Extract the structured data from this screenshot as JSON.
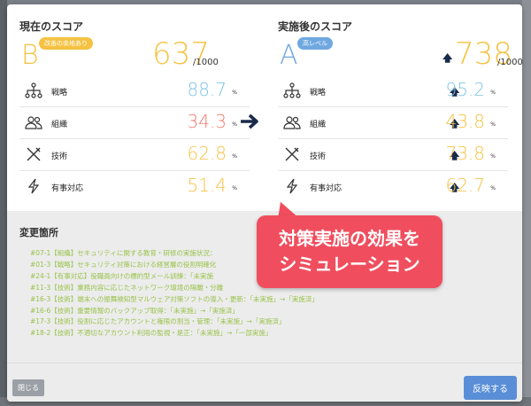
{
  "colors": {
    "grade_b": "#f5c242",
    "grade_a": "#6fa8e0",
    "badge_b": "#f5c242",
    "badge_a": "#6fa8e0",
    "strategy": "#7ec3e6",
    "organization": "#ee7b6d",
    "technology": "#f5c242",
    "incident": "#f5c242",
    "changes_text": "#9ac24b",
    "callout": "#f04e5e",
    "apply_button": "#5a8fd8"
  },
  "current": {
    "title": "現在のスコア",
    "grade": "B",
    "badge": "改善の余地あり",
    "score": "637",
    "max": "/1000",
    "metrics": [
      {
        "label": "戦略",
        "value": "88.7",
        "unit": "%",
        "icon": "hierarchy-icon"
      },
      {
        "label": "組織",
        "value": "34.3",
        "unit": "%",
        "icon": "people-icon"
      },
      {
        "label": "技術",
        "value": "62.8",
        "unit": "%",
        "icon": "tools-icon"
      },
      {
        "label": "有事対応",
        "value": "51.4",
        "unit": "%",
        "icon": "lightning-icon"
      }
    ]
  },
  "after": {
    "title": "実施後のスコア",
    "grade": "A",
    "badge": "高レベル",
    "score": "738",
    "max": "/1000",
    "metrics": [
      {
        "label": "戦略",
        "value": "95.2",
        "unit": "%",
        "icon": "hierarchy-icon"
      },
      {
        "label": "組織",
        "value": "43.8",
        "unit": "%",
        "icon": "people-icon"
      },
      {
        "label": "技術",
        "value": "73.8",
        "unit": "%",
        "icon": "tools-icon"
      },
      {
        "label": "有事対応",
        "value": "62.7",
        "unit": "%",
        "icon": "lightning-icon"
      }
    ]
  },
  "changes": {
    "title": "変更箇所",
    "items": [
      "#07-1【組織】セキュリティに関する教育・研修の実施状況：",
      "#01-3【戦略】セキュリティ対策における経営層の役割明確化",
      "#24-1【有事対応】役職員向けの標的型メール訓練：「未実施",
      "#11-3【技術】業務内容に応じたネットワーク環境の隔離・分離",
      "#16-3【技術】端末への振舞検知型マルウェア対策ソフトの導入・更新：「未実施」→「実施済」",
      "#16-6【技術】重要情報のバックアップ取得：「未実施」→「実施済」",
      "#17-3【技術】役割に応じたアカウントと権限の割当・管理：「未実施」→「実施済」",
      "#18-2【技術】不適切なアカウント利用の監視・是正：「未実施」→「一部実施」"
    ]
  },
  "callout": {
    "line1": "対策実施の効果を",
    "line2": "シミュレーション"
  },
  "footer": {
    "close_label": "閉じる",
    "apply_label": "反映する"
  }
}
